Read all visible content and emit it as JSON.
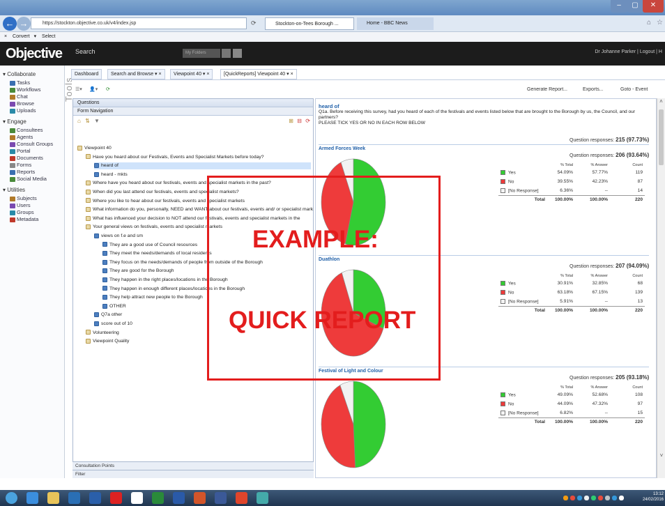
{
  "browser": {
    "address": "https://stockton.objective.co.uk/v4/index.jsp",
    "tabs": [
      "Stockton-on-Tees Borough ...",
      "Home - BBC News"
    ],
    "command_items": [
      "Convert",
      "Select"
    ]
  },
  "app": {
    "logo": "Objective",
    "search_label": "Search",
    "search_scope": "My Folders",
    "user": "Dr Johanne Parker | Logout | H"
  },
  "sidebar": {
    "groups": [
      {
        "label": "Collaborate",
        "items": [
          "Tasks",
          "Workflows",
          "Chat",
          "Browse",
          "Uploads"
        ]
      },
      {
        "label": "Engage",
        "items": [
          "Consultees",
          "Agents",
          "Consult Groups",
          "Portal",
          "Documents",
          "Forms",
          "Reports",
          "Social Media"
        ]
      },
      {
        "label": "Utilities",
        "items": [
          "Subjects",
          "Users",
          "Groups",
          "Metadata"
        ]
      }
    ],
    "tools_label": "Tools"
  },
  "tabs": [
    "Dashboard",
    "Search and Browse",
    "Viewpoint 40",
    "[QuickReports] Viewpoint 40"
  ],
  "toolbar": {
    "generate": "Generate Report...",
    "exports": "Exports...",
    "goto": "Goto - Event"
  },
  "questions_panel": {
    "title": "Questions",
    "subtitle": "Form Navigation",
    "tree": [
      {
        "label": "Viewpoint 40",
        "level": 0
      },
      {
        "label": "Have you heard about our Festivals, Events and Specialist Markets before today?",
        "level": 1
      },
      {
        "label": "heard of",
        "level": 2,
        "selected": true
      },
      {
        "label": "heard - mkts",
        "level": 2
      },
      {
        "label": "Where have you heard about our festivals, events and specialist markets in the past?",
        "level": 1
      },
      {
        "label": "When did you last attend our festivals, events and specialist markets?",
        "level": 1
      },
      {
        "label": "Where you like to hear about our festivals, events and specialist markets",
        "level": 1
      },
      {
        "label": "What information do you, personally, NEED and WANT about our festivals, events and/ or specialist markets?",
        "level": 1
      },
      {
        "label": "What has influenced your decision to NOT attend our festivals, events and specialist markets in the",
        "level": 1
      },
      {
        "label": "Your general views on festivals, events and specialist markets",
        "level": 1
      },
      {
        "label": "views on f.e and sm",
        "level": 2
      },
      {
        "label": "They are a good use of Council resources",
        "level": 3
      },
      {
        "label": "They meet the needs/demands of local residents",
        "level": 3
      },
      {
        "label": "They focus on the needs/demands of people from outside of the Borough",
        "level": 3
      },
      {
        "label": "They are good for the Borough",
        "level": 3
      },
      {
        "label": "They happen in the right places/locations in the Borough",
        "level": 3
      },
      {
        "label": "They happen in enough different places/locations in the Borough",
        "level": 3
      },
      {
        "label": "They help attract new people to the Borough",
        "level": 3
      },
      {
        "label": "OTHER",
        "level": 3
      },
      {
        "label": "Q7a other",
        "level": 2
      },
      {
        "label": "score out of 10",
        "level": 2
      },
      {
        "label": "Volunteering",
        "level": 1
      },
      {
        "label": "Viewpoint Quality",
        "level": 1
      }
    ],
    "footer1": "Consultation Points",
    "footer2": "Filter"
  },
  "report": {
    "title": "heard of",
    "question": "Q1a. Before receiving this survey, had you heard of each of the festivals and events listed below that are brought to the Borough by us, the Council, and our partners?",
    "instruction": "PLEASE TICK YES OR NO IN EACH ROW BELOW",
    "overall_label": "Question responses:",
    "overall_value": "215 (97.73%)",
    "col_total": "% Total",
    "col_answer": "% Answer",
    "col_count": "Count",
    "total_label": "Total",
    "sections": [
      {
        "name": "Armed Forces Week",
        "responses": "206 (93.64%)",
        "rows": [
          {
            "label": "Yes",
            "total": "54.09%",
            "answer": "57.77%",
            "count": "119",
            "color": "#33cc33"
          },
          {
            "label": "No",
            "total": "39.55%",
            "answer": "42.23%",
            "count": "87",
            "color": "#ee3b3b"
          },
          {
            "label": "[No Response]",
            "total": "6.36%",
            "answer": "--",
            "count": "14",
            "color": "#f4f4f4"
          }
        ],
        "totals": {
          "total": "100.00%",
          "answer": "100.00%",
          "count": "220"
        },
        "pie": [
          54.09,
          39.55,
          6.36
        ]
      },
      {
        "name": "Duathlon",
        "responses": "207 (94.09%)",
        "rows": [
          {
            "label": "Yes",
            "total": "30.91%",
            "answer": "32.85%",
            "count": "68",
            "color": "#33cc33"
          },
          {
            "label": "No",
            "total": "63.18%",
            "answer": "67.15%",
            "count": "139",
            "color": "#ee3b3b"
          },
          {
            "label": "[No Response]",
            "total": "5.91%",
            "answer": "--",
            "count": "13",
            "color": "#f4f4f4"
          }
        ],
        "totals": {
          "total": "100.00%",
          "answer": "100.00%",
          "count": "220"
        },
        "pie": [
          30.91,
          63.18,
          5.91
        ]
      },
      {
        "name": "Festival of Light and Colour",
        "responses": "205 (93.18%)",
        "rows": [
          {
            "label": "Yes",
            "total": "49.09%",
            "answer": "52.68%",
            "count": "108",
            "color": "#33cc33"
          },
          {
            "label": "No",
            "total": "44.09%",
            "answer": "47.32%",
            "count": "97",
            "color": "#ee3b3b"
          },
          {
            "label": "[No Response]",
            "total": "6.82%",
            "answer": "--",
            "count": "15",
            "color": "#f4f4f4"
          }
        ],
        "totals": {
          "total": "100.00%",
          "answer": "100.00%",
          "count": "220"
        },
        "pie": [
          49.09,
          44.09,
          6.82
        ]
      }
    ]
  },
  "overlay": {
    "line1": "EXAMPLE:",
    "line2": "QUICK REPORT"
  },
  "clock": {
    "time": "13:12",
    "date": "24/02/2016"
  }
}
